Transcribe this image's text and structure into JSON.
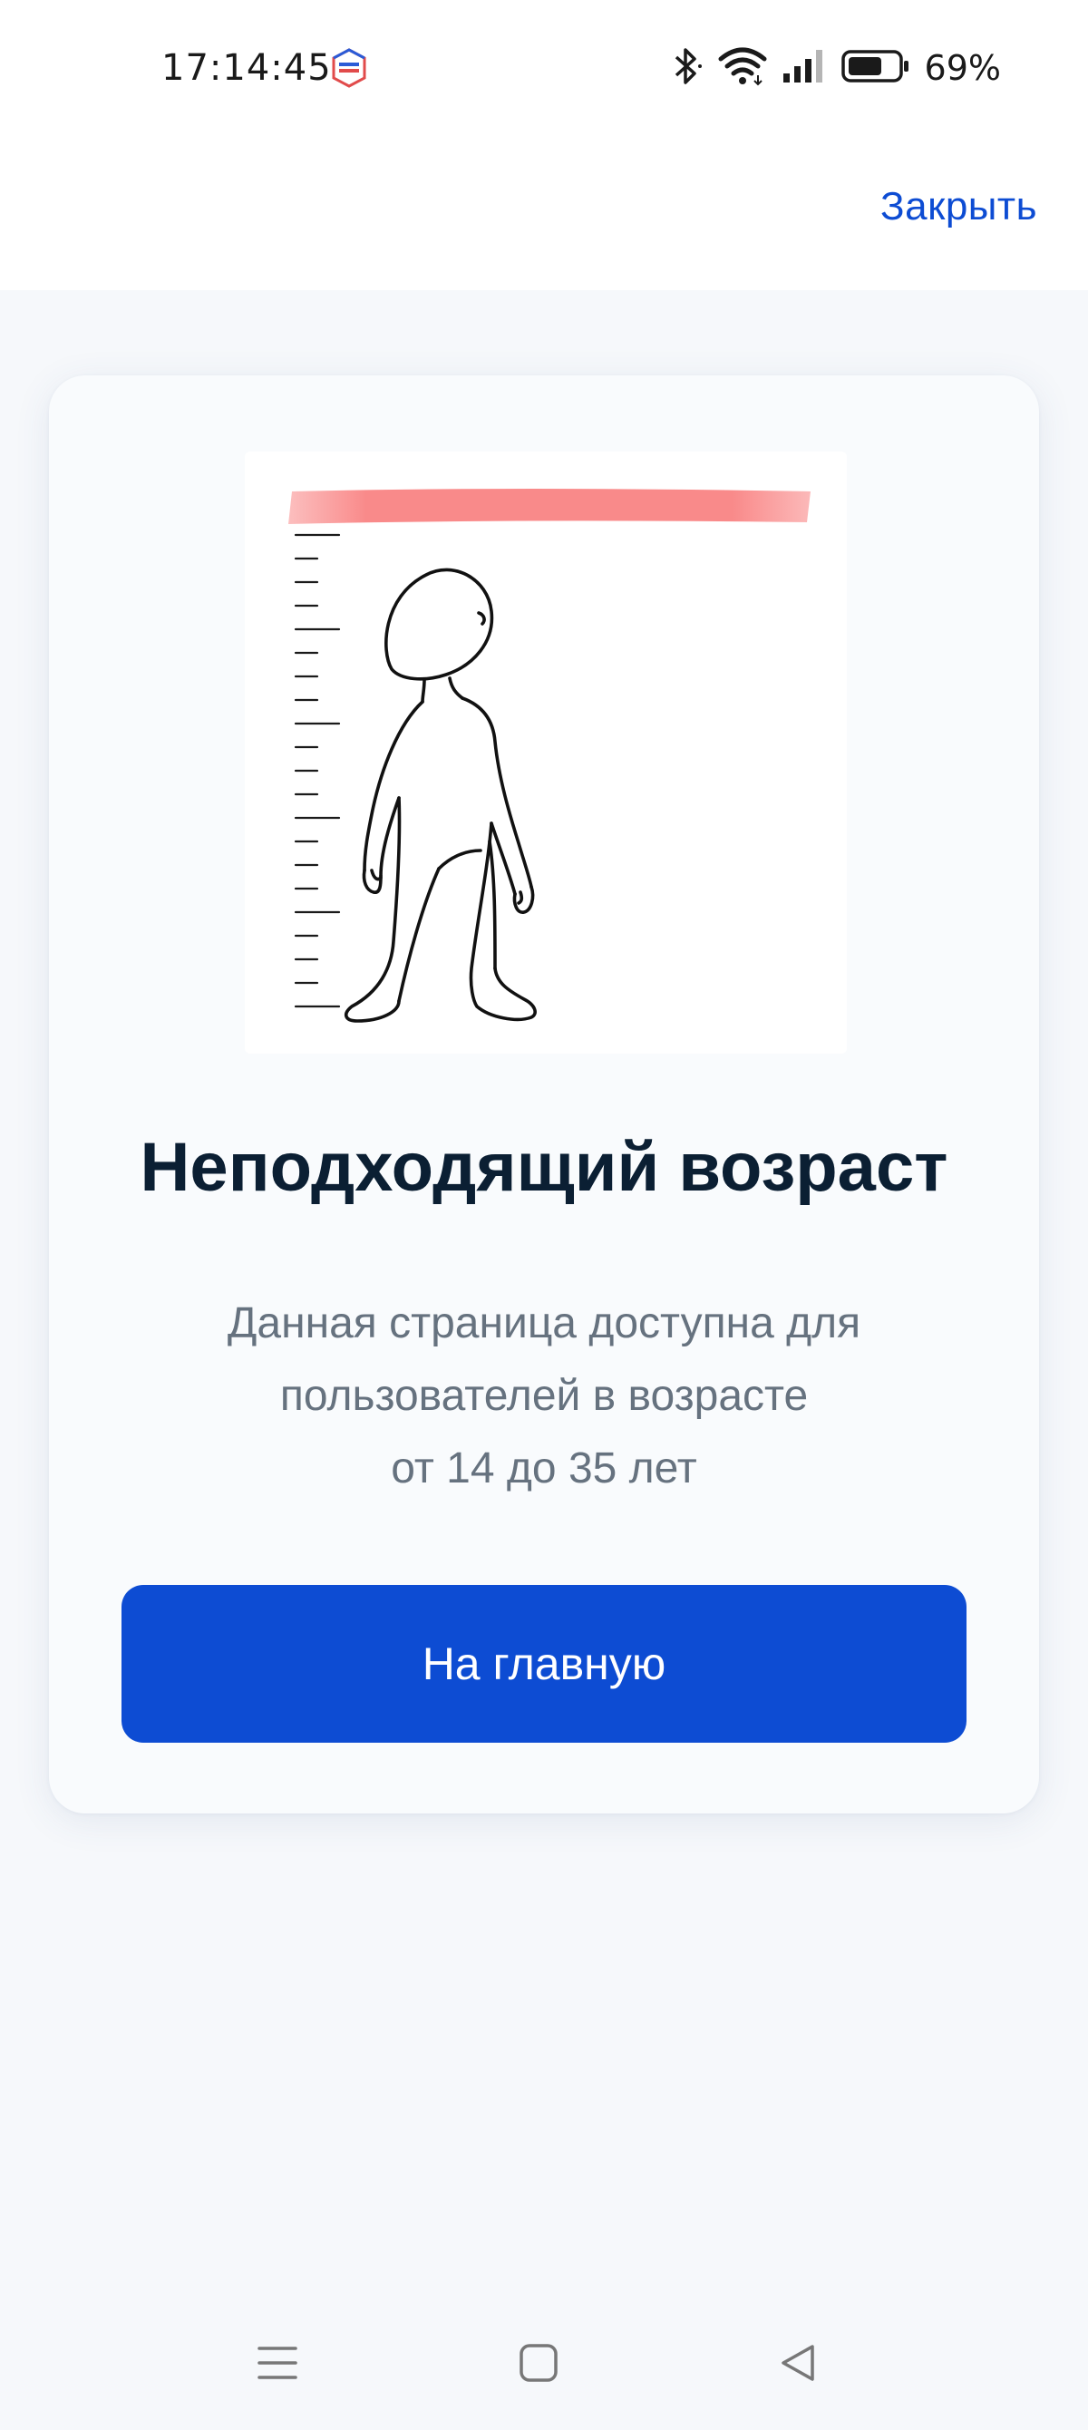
{
  "status_bar": {
    "time": "17:14:45",
    "battery_percent": "69%",
    "app_icon": "gosuslugi-icon",
    "battery_level": 0.69
  },
  "header": {
    "close_label": "Закрыть"
  },
  "card": {
    "illustration": "height-measurement-illustration",
    "title": "Неподходящий возраст",
    "text_lines": [
      "Данная страница доступна для",
      "пользователей в возрасте",
      "от 14 до 35 лет"
    ],
    "button_label": "На главную"
  },
  "nav_bar": {
    "items": [
      "menu-icon",
      "home-icon",
      "back-icon"
    ]
  },
  "colors": {
    "accent": "#0d4cd3",
    "title": "#0b1f33",
    "muted_text": "#66727f",
    "height_bar": "#f98a8a"
  }
}
